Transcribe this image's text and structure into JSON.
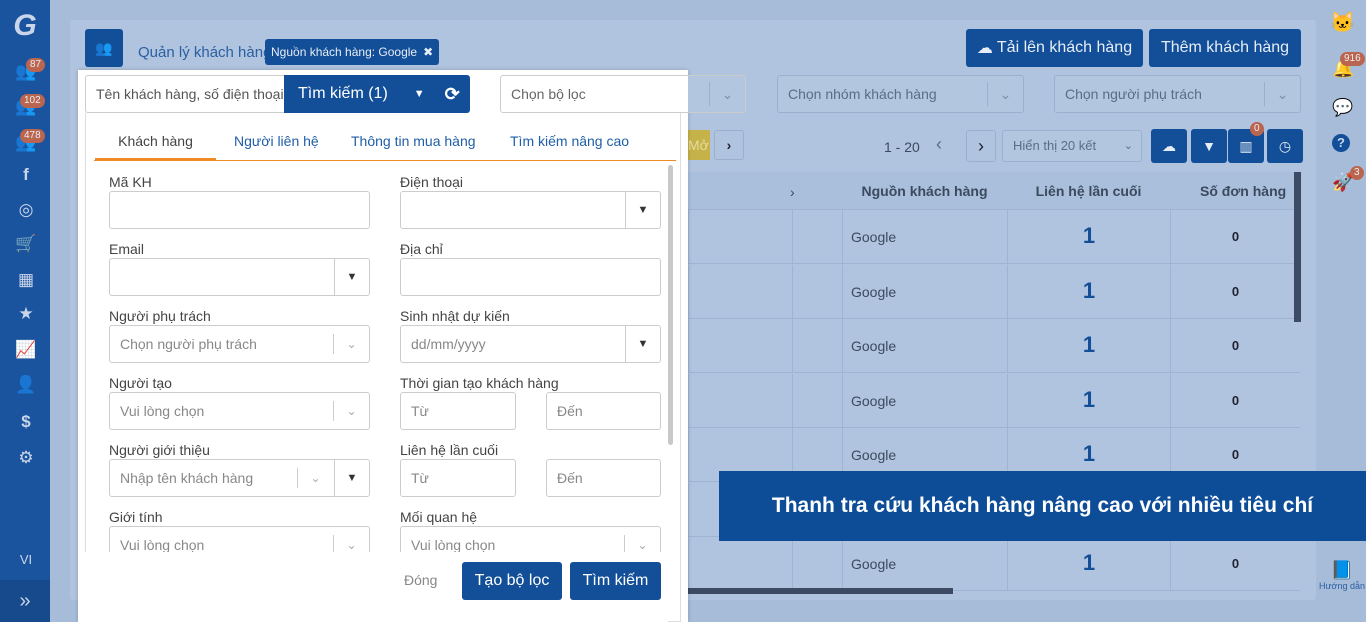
{
  "sidebar": {
    "badges": [
      "87",
      "102",
      "478"
    ],
    "language": "VI",
    "icons": [
      "logo-icon",
      "users-icon",
      "users-icon",
      "users-icon",
      "facebook-icon",
      "target-icon",
      "cart-icon",
      "cubes-icon",
      "star-icon",
      "chart-icon",
      "user-tie-icon",
      "dollar-icon",
      "gear-icon"
    ]
  },
  "header": {
    "breadcrumb": "Quản lý khách hàng",
    "filter_tag": "Nguồn khách hàng: Google",
    "upload_button": "Tải lên khách hàng",
    "add_button": "Thêm khách hàng"
  },
  "filters": {
    "filter_placeholder": "Chọn bộ lọc",
    "group_placeholder": "Chọn nhóm khách hàng",
    "owner_placeholder": "Chọn người phụ trách"
  },
  "pagination": {
    "range": "1 - 20",
    "page_size": "Hiển thị 20 kết",
    "more_label": "Mở",
    "column_badge": "0"
  },
  "table": {
    "headers": [
      "Nguồn khách hàng",
      "Liên hệ lần cuối",
      "Số đơn hàng"
    ],
    "rows": [
      [
        "Google",
        "1",
        "0"
      ],
      [
        "Google",
        "1",
        "0"
      ],
      [
        "Google",
        "1",
        "0"
      ],
      [
        "Google",
        "1",
        "0"
      ],
      [
        "Google",
        "1",
        "0"
      ],
      [
        "Google",
        "1",
        "0"
      ],
      [
        "Google",
        "1",
        "0"
      ]
    ]
  },
  "right_rail": {
    "notification_badge": "916",
    "rocket_badge": "3",
    "guide_label": "Hướng dẫn"
  },
  "popup": {
    "search_placeholder": "Tên khách hàng, số điện thoại",
    "search_button": "Tìm kiếm (1)",
    "tabs": [
      "Khách hàng",
      "Người liên hệ",
      "Thông tin mua hàng",
      "Tìm kiếm nâng cao"
    ],
    "fields": {
      "ma_kh": "Mã KH",
      "dien_thoai": "Điện thoại",
      "email": "Email",
      "dia_chi": "Địa chỉ",
      "nguoi_phu_trach": "Người phụ trách",
      "nguoi_phu_trach_ph": "Chọn người phụ trách",
      "sinh_nhat": "Sinh nhật dự kiến",
      "sinh_nhat_ph": "dd/mm/yyyy",
      "nguoi_tao": "Người tạo",
      "nguoi_tao_ph": "Vui lòng chọn",
      "thoi_gian_tao": "Thời gian tạo khách hàng",
      "tu": "Từ",
      "den": "Đến",
      "nguoi_gioi_thieu": "Người giới thiệu",
      "nguoi_gioi_thieu_ph": "Nhập tên khách hàng",
      "lien_he_cuoi": "Liên hệ lần cuối",
      "gioi_tinh": "Giới tính",
      "gioi_tinh_ph": "Vui lòng chọn",
      "moi_quan_he": "Mối quan hệ",
      "moi_quan_he_ph": "Vui lòng chọn"
    },
    "close_button": "Đóng",
    "create_filter_button": "Tạo bộ lọc",
    "submit_button": "Tìm kiếm"
  },
  "banner": "Thanh tra cứu khách hàng nâng cao với nhiều tiêu chí",
  "colors": {
    "primary": "#134f98",
    "accent": "#f08a24",
    "banner": "#0d4c97"
  }
}
